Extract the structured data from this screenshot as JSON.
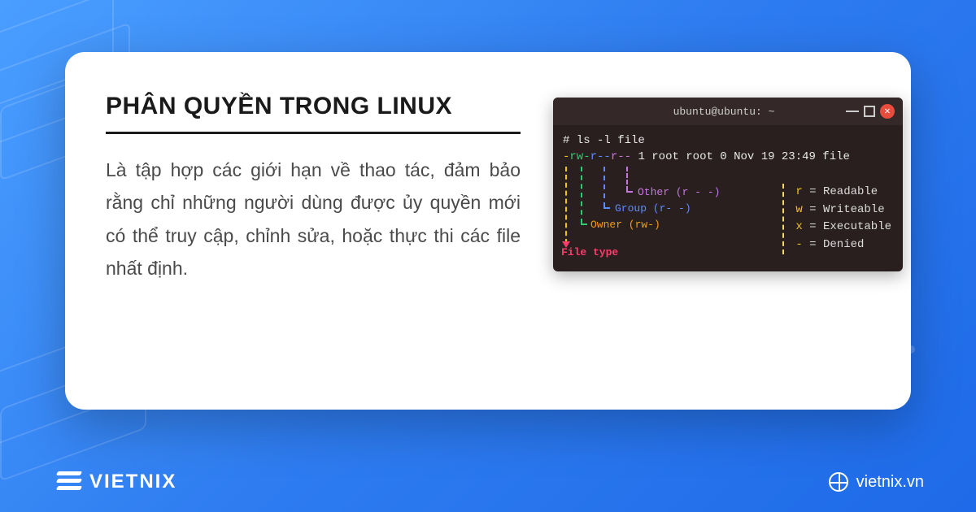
{
  "brand": {
    "name": "VIETNIX",
    "site_url": "vietnix.vn"
  },
  "card": {
    "title": "PHÂN QUYỀN TRONG LINUX",
    "description": "Là tập hợp các giới hạn về thao tác, đảm bảo rằng chỉ những người dùng được ủy quyền mới có thể truy cập, chỉnh sửa, hoặc thực thi các file nhất định."
  },
  "terminal": {
    "window_title": "ubuntu@ubuntu: ~",
    "command": "# ls -l file",
    "output": {
      "perm_dash": "-",
      "perm_owner": "rw-",
      "perm_group": "r--",
      "perm_other": "r--",
      "rest": " 1 root root 0 Nov 19 23:49 file"
    },
    "labels": {
      "other": "Other (r - -)",
      "group": "Group (r- -)",
      "owner": "Owner (rw-)",
      "file_type": "File type"
    },
    "legend": {
      "r": {
        "key": "r",
        "value": "Readable"
      },
      "w": {
        "key": "w",
        "value": "Writeable"
      },
      "x": {
        "key": "x",
        "value": "Executable"
      },
      "dash": {
        "key": "-",
        "value": "Denied"
      }
    }
  }
}
